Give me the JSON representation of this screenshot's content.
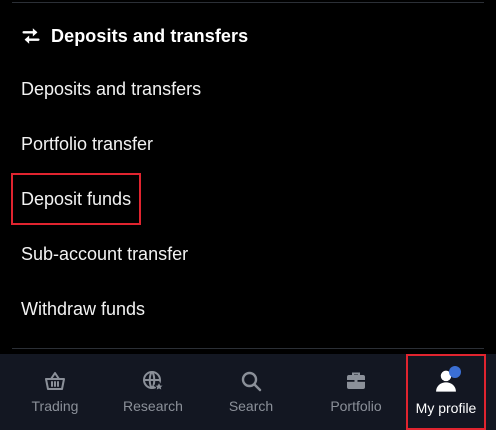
{
  "section": {
    "icon": "swap-arrows-icon",
    "title": "Deposits and transfers"
  },
  "menu": {
    "items": [
      {
        "label": "Deposits and transfers",
        "highlighted": false
      },
      {
        "label": "Portfolio transfer",
        "highlighted": false
      },
      {
        "label": "Deposit funds",
        "highlighted": true
      },
      {
        "label": "Sub-account transfer",
        "highlighted": false
      },
      {
        "label": "Withdraw funds",
        "highlighted": false
      }
    ]
  },
  "bottom_nav": {
    "items": [
      {
        "label": "Trading",
        "icon": "basket-icon",
        "active": false
      },
      {
        "label": "Research",
        "icon": "globe-star-icon",
        "active": false
      },
      {
        "label": "Search",
        "icon": "search-icon",
        "active": false
      },
      {
        "label": "Portfolio",
        "icon": "briefcase-icon",
        "active": false
      },
      {
        "label": "My profile",
        "icon": "user-icon",
        "active": true
      }
    ]
  },
  "colors": {
    "background": "#000000",
    "nav_background": "#131722",
    "inactive_text": "#8b9099",
    "highlight_border": "#e0242f",
    "notification_dot": "#3b6fd4"
  }
}
